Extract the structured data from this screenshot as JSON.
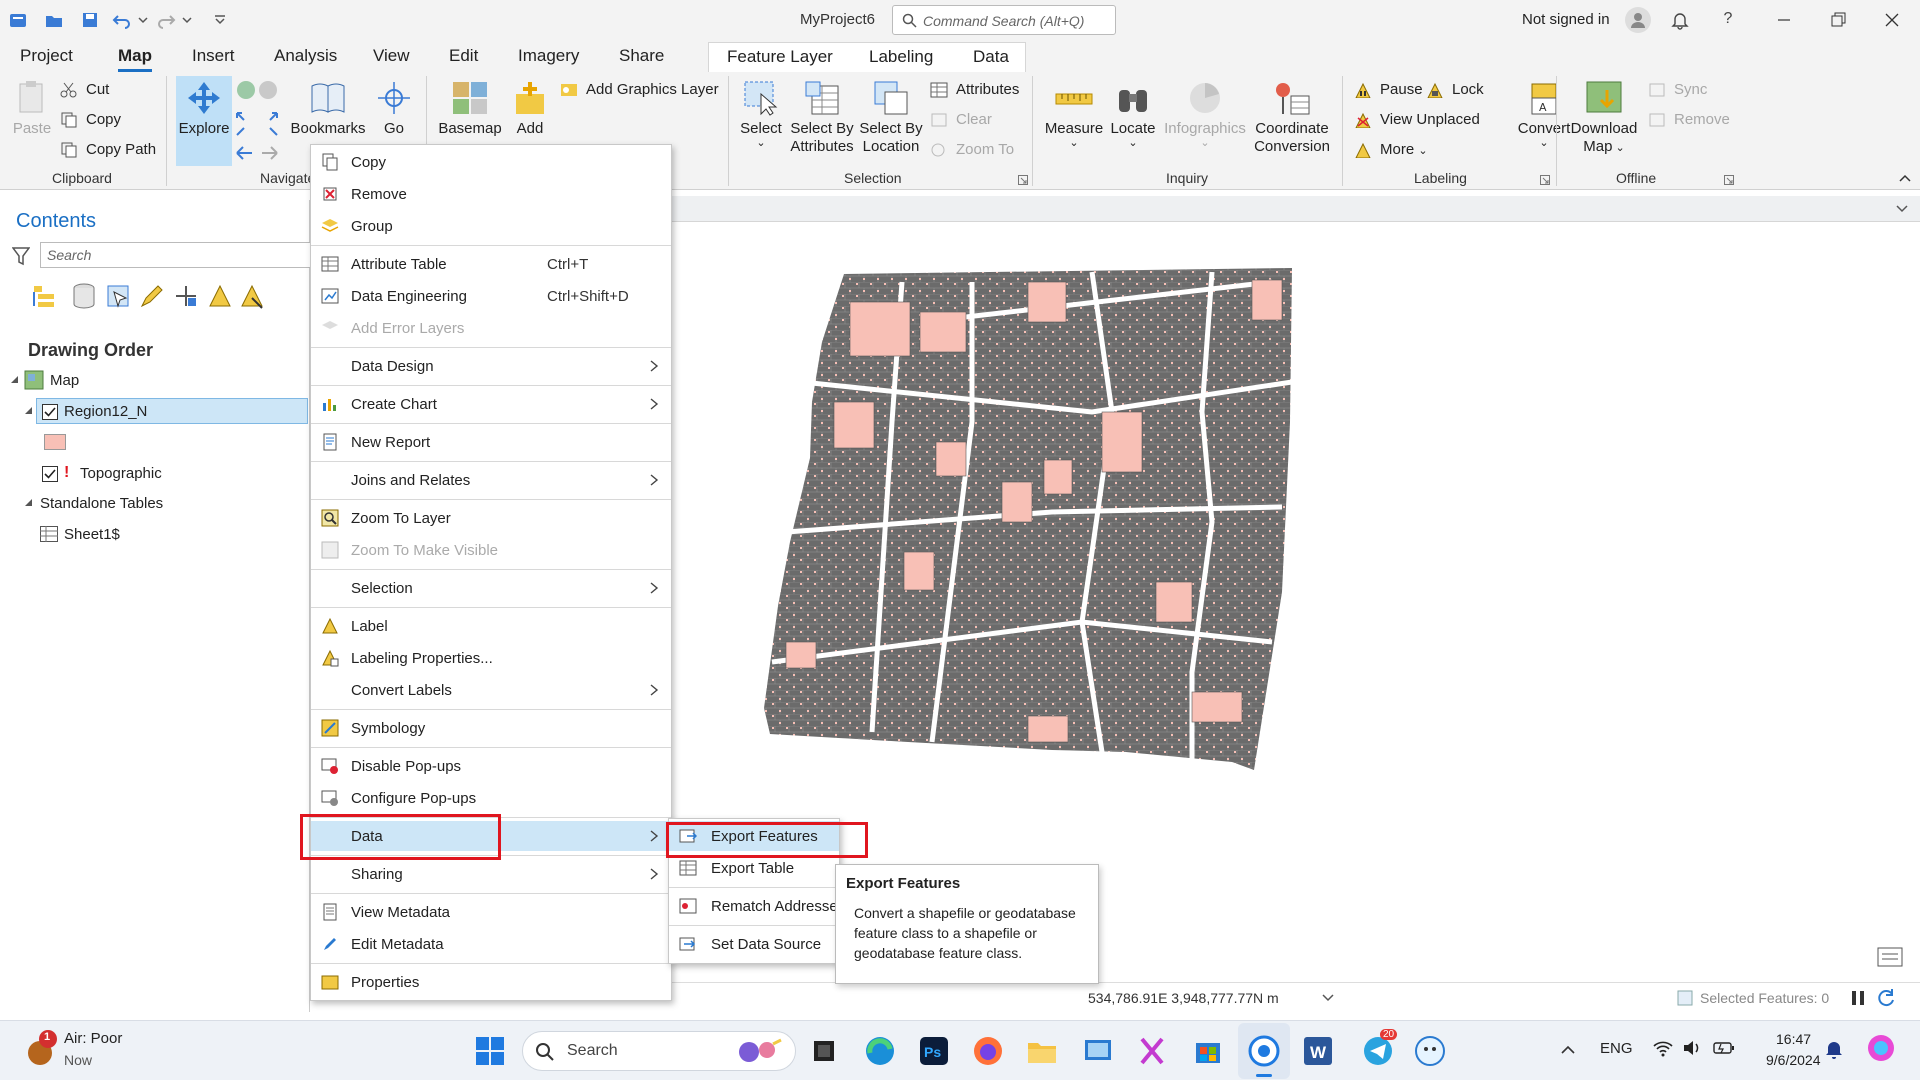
{
  "titlebar": {
    "project_name": "MyProject6",
    "command_search_placeholder": "Command Search (Alt+Q)",
    "signin_status": "Not signed in"
  },
  "ribbon_tabs": [
    "Project",
    "Map",
    "Insert",
    "Analysis",
    "View",
    "Edit",
    "Imagery",
    "Share"
  ],
  "active_tab": "Map",
  "contextual_tabs": [
    "Feature Layer",
    "Labeling",
    "Data"
  ],
  "ribbon": {
    "clipboard": {
      "paste": "Paste",
      "cut": "Cut",
      "copy": "Copy",
      "copy_path": "Copy Path",
      "group": "Clipboard"
    },
    "navigate": {
      "explore": "Explore",
      "bookmarks": "Bookmarks",
      "go": "Go",
      "group": "Navigate"
    },
    "layer": {
      "basemap": "Basemap",
      "add": "Add",
      "add_graphics_layer": "Add Graphics Layer"
    },
    "selection": {
      "select": "Select",
      "select_by_attributes_1": "Select By",
      "select_by_attributes_2": "Attributes",
      "select_by_location_1": "Select By",
      "select_by_location_2": "Location",
      "attributes": "Attributes",
      "clear": "Clear",
      "zoom_to": "Zoom To",
      "group": "Selection"
    },
    "inquiry": {
      "measure": "Measure",
      "locate": "Locate",
      "infographics": "Infographics",
      "coordinate_1": "Coordinate",
      "coordinate_2": "Conversion",
      "group": "Inquiry"
    },
    "labeling": {
      "pause": "Pause",
      "lock": "Lock",
      "view_unplaced": "View Unplaced",
      "more": "More",
      "convert": "Convert",
      "group": "Labeling"
    },
    "offline": {
      "download_1": "Download",
      "download_2": "Map",
      "sync": "Sync",
      "remove": "Remove",
      "group": "Offline"
    }
  },
  "contents": {
    "title": "Contents",
    "search_placeholder": "Search",
    "drawing_order": "Drawing Order",
    "map": "Map",
    "layer": "Region12_N",
    "topographic": "Topographic",
    "standalone_tables": "Standalone Tables",
    "table": "Sheet1$"
  },
  "context_menu": {
    "copy": "Copy",
    "remove": "Remove",
    "group": "Group",
    "attribute_table": "Attribute Table",
    "attribute_table_sc": "Ctrl+T",
    "data_engineering": "Data Engineering",
    "data_engineering_sc": "Ctrl+Shift+D",
    "add_error_layers": "Add Error Layers",
    "data_design": "Data Design",
    "create_chart": "Create Chart",
    "new_report": "New Report",
    "joins_relates": "Joins and Relates",
    "zoom_to_layer": "Zoom To Layer",
    "zoom_visible": "Zoom To Make Visible",
    "selection": "Selection",
    "label": "Label",
    "labeling_properties": "Labeling Properties...",
    "convert_labels": "Convert Labels",
    "symbology": "Symbology",
    "disable_popups": "Disable Pop-ups",
    "configure_popups": "Configure Pop-ups",
    "data": "Data",
    "sharing": "Sharing",
    "view_metadata": "View Metadata",
    "edit_metadata": "Edit Metadata",
    "properties": "Properties"
  },
  "submenu": {
    "export_features": "Export Features",
    "export_table": "Export Table",
    "rematch_addresses": "Rematch Addresses",
    "set_data_source": "Set Data Source"
  },
  "tooltip": {
    "title": "Export Features",
    "body": "Convert a shapefile or geodatabase feature class to a shapefile or geodatabase feature class."
  },
  "statusbar": {
    "coordinates": "534,786.91E 3,948,777.77N m",
    "selected_features": "Selected Features: 0"
  },
  "taskbar": {
    "weather_title": "Air: Poor",
    "weather_sub": "Now",
    "weather_badge": "1",
    "search": "Search",
    "telegram_badge": "20",
    "language": "ENG",
    "time": "16:47",
    "date": "9/6/2024"
  },
  "colors": {
    "accent": "#1a6fc4",
    "highlight": "#cde6f7",
    "red_outline": "#e0161f",
    "parcel_fill": "#f8c0b6",
    "block_fill": "#6b6b6b"
  }
}
